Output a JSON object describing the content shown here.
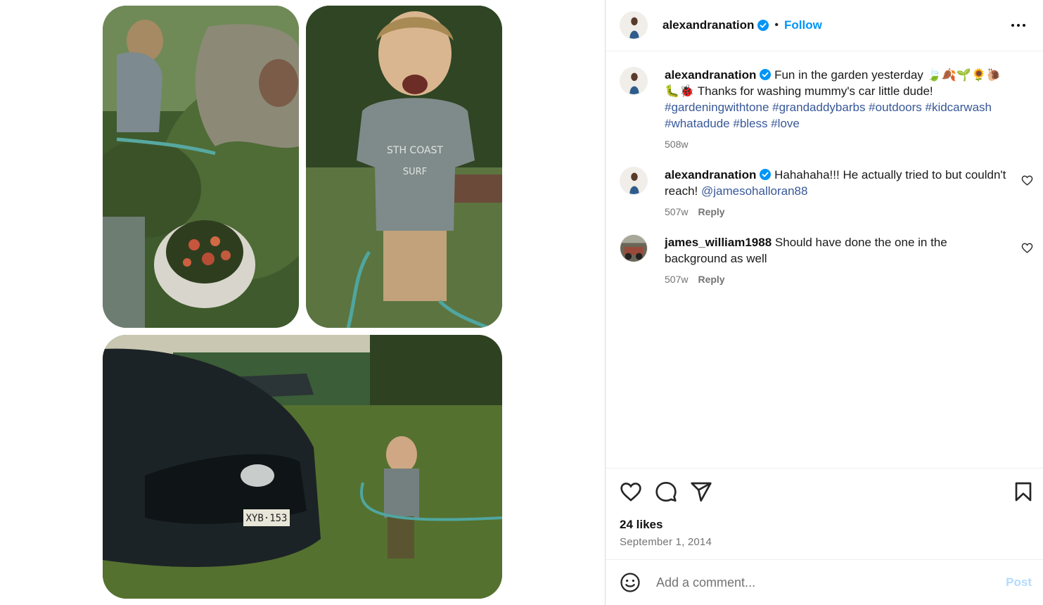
{
  "post": {
    "username": "alexandranation",
    "follow_label": "Follow",
    "dot": "•",
    "more_icon": "more-options-icon"
  },
  "comments": [
    {
      "username": "alexandranation",
      "verified": true,
      "text": " Fun in the garden yesterday 🍃🍂🌱🌻🐌 🐛🐞 Thanks for washing mummy's car little dude!",
      "hashtags": "#gardeningwithtone #grandaddybarbs #outdoors #kidcarwash #whatadude #bless #love",
      "time": "508w"
    },
    {
      "username": "alexandranation",
      "verified": true,
      "text": " Hahahaha!!! He actually tried to but couldn't reach! ",
      "mention": "@jamesohalloran88",
      "time": "507w",
      "reply_label": "Reply"
    },
    {
      "username": "james_william1988",
      "verified": false,
      "text": " Should have done the one in the background as well",
      "time": "507w",
      "reply_label": "Reply"
    }
  ],
  "actions": {
    "likes": "24 likes",
    "date": "September 1, 2014",
    "icons": [
      "heart-icon",
      "comment-icon",
      "share-icon",
      "bookmark-icon"
    ]
  },
  "add_comment": {
    "placeholder": "Add a comment...",
    "post_label": "Post"
  },
  "media": {
    "plate_text": "XYB·153",
    "shirt_text": "STH COAST SURF"
  },
  "colors": {
    "accent": "#0095f6",
    "link": "#385898",
    "muted": "#737373",
    "post_disabled": "#b3dbff"
  }
}
